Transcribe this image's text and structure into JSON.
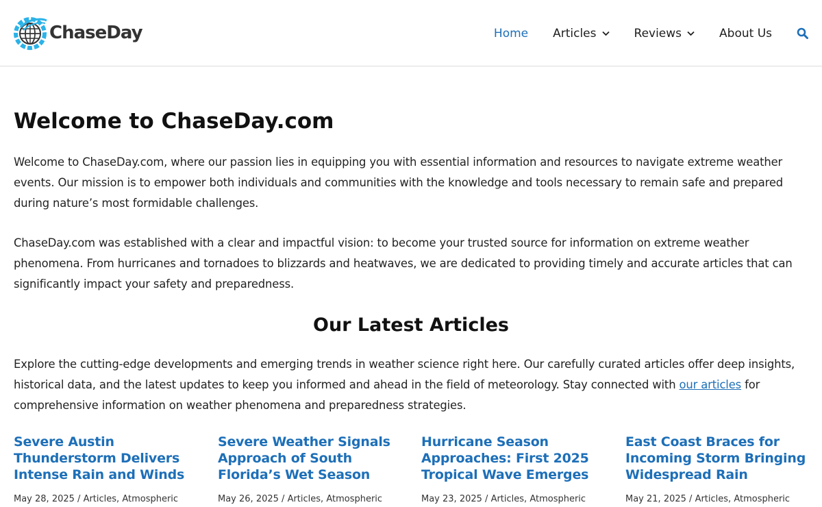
{
  "header": {
    "logo_text": "ChaseDay",
    "nav": [
      {
        "label": "Home",
        "active": true,
        "has_dropdown": false
      },
      {
        "label": "Articles",
        "active": false,
        "has_dropdown": true
      },
      {
        "label": "Reviews",
        "active": false,
        "has_dropdown": true
      },
      {
        "label": "About Us",
        "active": false,
        "has_dropdown": false
      }
    ],
    "search_icon": "search-icon"
  },
  "main": {
    "title": "Welcome to ChaseDay.com",
    "paragraph1": "Welcome to ChaseDay.com, where our passion lies in equipping you with essential information and resources to navigate extreme weather events. Our mission is to empower both individuals and communities with the knowledge and tools necessary to remain safe and prepared during nature’s most formidable challenges.",
    "paragraph2": "ChaseDay.com was established with a clear and impactful vision: to become your trusted source for information on extreme weather phenomena. From hurricanes and tornadoes to blizzards and heatwaves, we are dedicated to providing timely and accurate articles that can significantly impact your safety and preparedness.",
    "section_title": "Our Latest Articles",
    "paragraph3_before": "Explore the cutting-edge developments and emerging trends in weather science right here. Our carefully curated articles offer deep insights, historical data, and the latest updates to keep you informed and ahead in the field of meteorology. Stay connected with ",
    "paragraph3_link": "our articles",
    "paragraph3_after": " for comprehensive information on weather phenomena and preparedness strategies."
  },
  "articles": [
    {
      "title": "Severe Austin Thunderstorm Delivers Intense Rain and Winds",
      "date": "May 28, 2025",
      "sep": " / ",
      "cat1": "Articles",
      "comma": ", ",
      "cat2": "Atmospheric"
    },
    {
      "title": "Severe Weather Signals Approach of South Florida’s Wet Season",
      "date": "May 26, 2025",
      "sep": " / ",
      "cat1": "Articles",
      "comma": ", ",
      "cat2": "Atmospheric"
    },
    {
      "title": "Hurricane Season Approaches: First 2025 Tropical Wave Emerges",
      "date": "May 23, 2025",
      "sep": " / ",
      "cat1": "Articles",
      "comma": ", ",
      "cat2": "Atmospheric"
    },
    {
      "title": "East Coast Braces for Incoming Storm Bringing Widespread Rain",
      "date": "May 21, 2025",
      "sep": " / ",
      "cat1": "Articles",
      "comma": ", ",
      "cat2": "Atmospheric"
    }
  ],
  "colors": {
    "accent": "#1d6fb8",
    "logo_blue": "#2bb3e8",
    "logo_dark": "#333333"
  }
}
